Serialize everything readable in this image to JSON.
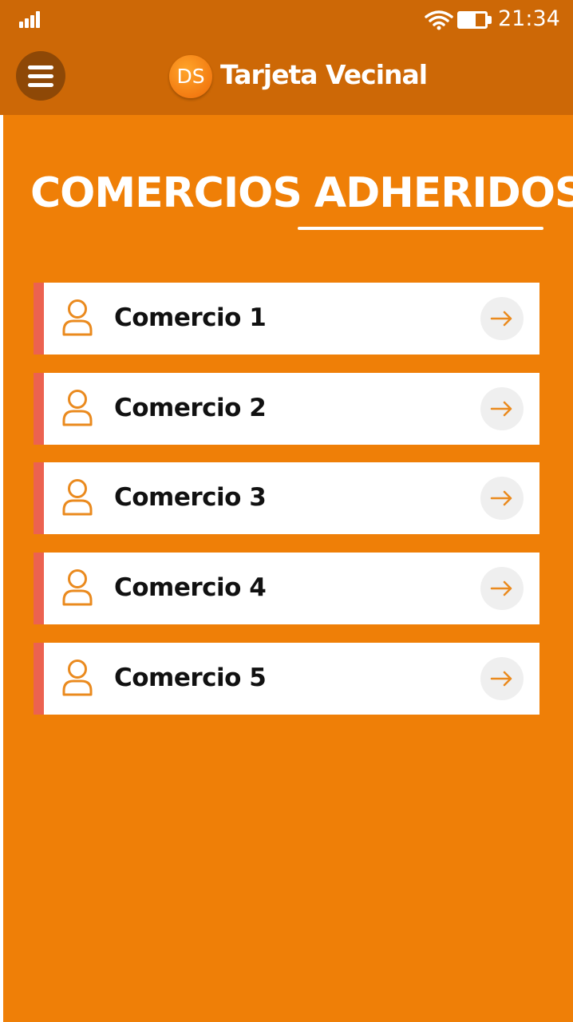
{
  "status_bar": {
    "time": "21:34",
    "icons": [
      "signal-icon",
      "wifi-icon",
      "battery-icon"
    ]
  },
  "header": {
    "menu_icon": "hamburger-menu-icon",
    "logo_text": "DS",
    "app_title": "Tarjeta Vecinal"
  },
  "page": {
    "title_part1": "COMERCIOS",
    "title_part2": "ADHERIDOS"
  },
  "comercios": [
    {
      "label": "Comercio 1",
      "icon": "user-icon",
      "action_icon": "arrow-right-icon"
    },
    {
      "label": "Comercio 2",
      "icon": "user-icon",
      "action_icon": "arrow-right-icon"
    },
    {
      "label": "Comercio 3",
      "icon": "user-icon",
      "action_icon": "arrow-right-icon"
    },
    {
      "label": "Comercio 4",
      "icon": "user-icon",
      "action_icon": "arrow-right-icon"
    },
    {
      "label": "Comercio 5",
      "icon": "user-icon",
      "action_icon": "arrow-right-icon"
    }
  ],
  "colors": {
    "background": "#EF7F07",
    "header": "#CD6806",
    "accent_stripe": "#EC6250",
    "icon_orange": "#EA8A1E"
  }
}
